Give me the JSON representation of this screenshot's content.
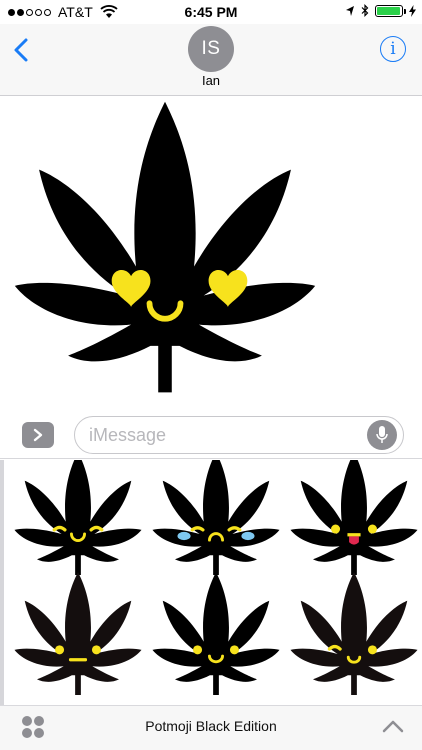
{
  "status_bar": {
    "carrier": "AT&T",
    "time": "6:45 PM",
    "signal_bars": 2,
    "signal_total": 5,
    "battery_level": 0.95
  },
  "header": {
    "avatar_initials": "IS",
    "contact_name": "Ian",
    "info_glyph": "i"
  },
  "input": {
    "placeholder": "iMessage"
  },
  "stickers": {
    "hero": {
      "face": "heart-eyes",
      "icon": "cannabis-leaf-heart-eyes-sticker"
    },
    "grid": [
      {
        "face": "happy-squint",
        "icon": "cannabis-leaf-happy-sticker"
      },
      {
        "face": "crying",
        "icon": "cannabis-leaf-crying-sticker"
      },
      {
        "face": "tongue-out",
        "icon": "cannabis-leaf-tongue-sticker"
      },
      {
        "face": "neutral",
        "icon": "cannabis-leaf-neutral-sticker"
      },
      {
        "face": "smile",
        "icon": "cannabis-leaf-smile-sticker"
      },
      {
        "face": "wink",
        "icon": "cannabis-leaf-wink-sticker"
      }
    ]
  },
  "footer": {
    "title": "Potmoji Black Edition"
  },
  "colors": {
    "accent": "#1a7cf6",
    "leaf": "#000000",
    "leaf_dark": "#140e0e",
    "face": "#f7e21d",
    "tears": "#7ec8f0",
    "tongue": "#e0284f"
  }
}
